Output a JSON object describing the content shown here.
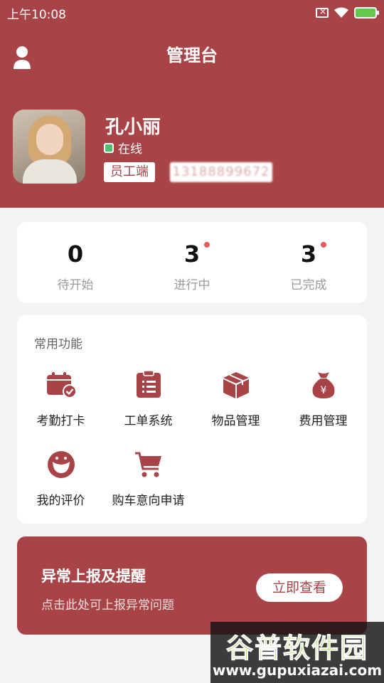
{
  "status_bar": {
    "time": "上午10:08"
  },
  "nav": {
    "title": "管理台"
  },
  "profile": {
    "name": "孔小丽",
    "status": "在线",
    "role": "员工端",
    "phone": "13188899672"
  },
  "stats": [
    {
      "value": "0",
      "label": "待开始",
      "has_dot": false
    },
    {
      "value": "3",
      "label": "进行中",
      "has_dot": true
    },
    {
      "value": "3",
      "label": "已完成",
      "has_dot": true
    }
  ],
  "functions": {
    "title": "常用功能",
    "items": [
      {
        "label": "考勤打卡",
        "icon": "calendar-check-icon"
      },
      {
        "label": "工单系统",
        "icon": "clipboard-icon"
      },
      {
        "label": "物品管理",
        "icon": "box-icon"
      },
      {
        "label": "费用管理",
        "icon": "money-bag-icon"
      },
      {
        "label": "我的评价",
        "icon": "smile-icon"
      },
      {
        "label": "购车意向申请",
        "icon": "cart-icon"
      }
    ]
  },
  "banner": {
    "title": "异常上报及提醒",
    "subtitle": "点击此处可上报异常问题",
    "button": "立即查看"
  },
  "watermark": {
    "text": "谷普软件园",
    "url": "www.gupuxiazai.com"
  },
  "colors": {
    "primary": "#a84447",
    "background": "#f3f3f3",
    "dot": "#e35b5b",
    "online": "#4ec06a"
  }
}
